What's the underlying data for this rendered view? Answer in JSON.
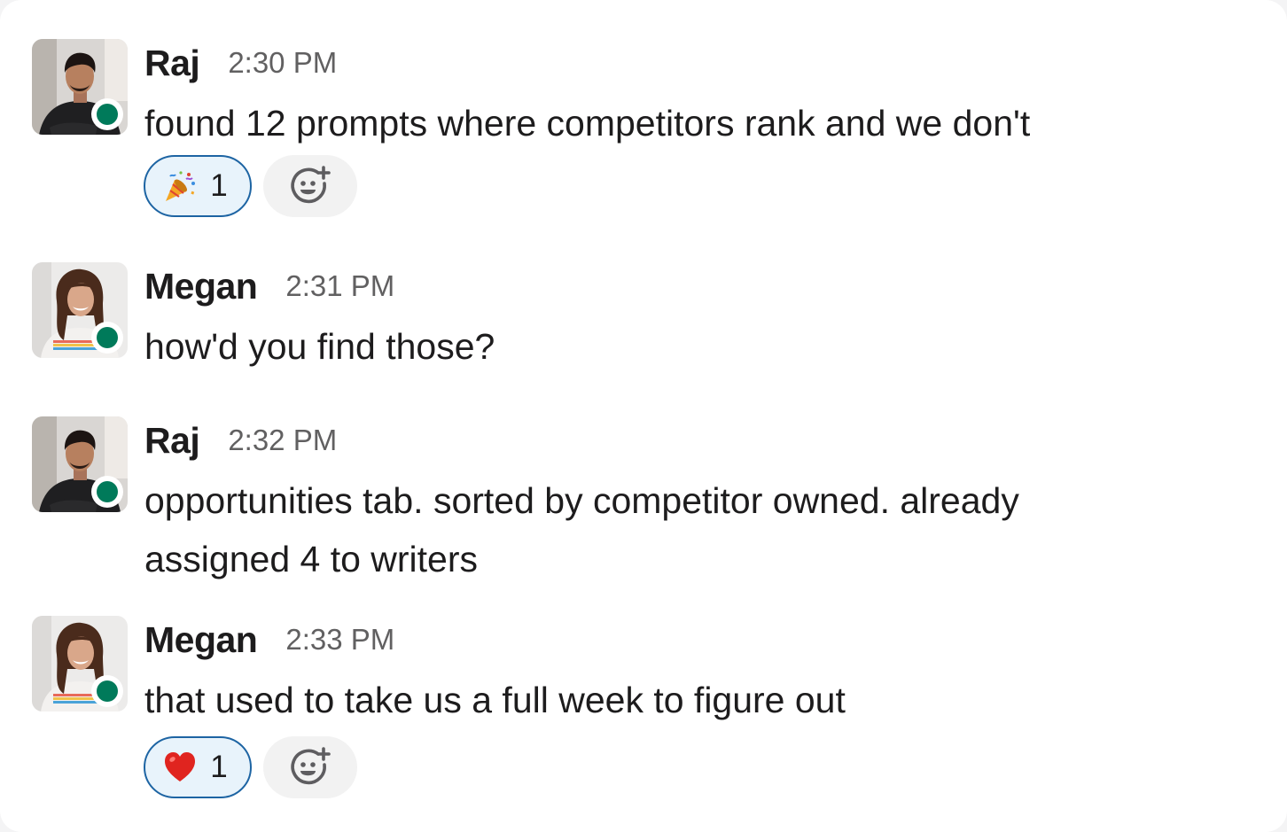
{
  "messages": [
    {
      "author": "Raj",
      "time": "2:30 PM",
      "text": "found 12 prompts where competitors rank and we don't",
      "avatar": "raj-avatar",
      "presence": "online",
      "reactions": [
        {
          "emoji": "party-popper-icon",
          "count": "1",
          "active": true
        }
      ]
    },
    {
      "author": "Megan",
      "time": "2:31 PM",
      "text": "how'd you find those?",
      "avatar": "megan-avatar",
      "presence": "online"
    },
    {
      "author": "Raj",
      "time": "2:32 PM",
      "text": "opportunities tab. sorted by competitor owned. already\nassigned 4 to writers",
      "avatar": "raj-avatar",
      "presence": "online"
    },
    {
      "author": "Megan",
      "time": "2:33 PM",
      "text": "that used to take us a full week to figure out",
      "avatar": "megan-avatar",
      "presence": "online",
      "reactions": [
        {
          "emoji": "red-heart-icon",
          "count": "1",
          "active": true
        }
      ]
    }
  ],
  "add_reaction_icon": "add-reaction-icon",
  "colors": {
    "presence": "#007a5a",
    "reaction_active_bg": "#e8f3fb",
    "reaction_active_border": "#1d64a3",
    "timestamp": "#616061",
    "text": "#1d1c1d"
  }
}
